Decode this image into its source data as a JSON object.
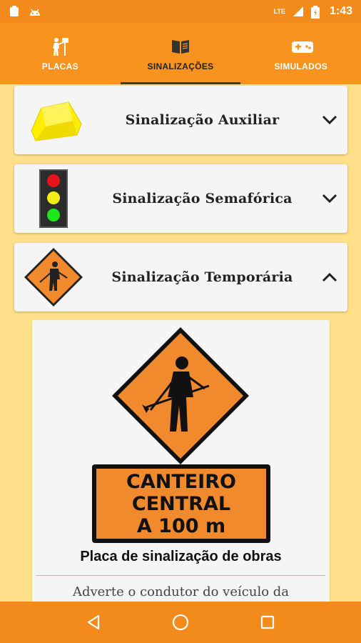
{
  "status": {
    "time": "1:43",
    "network": "LTE"
  },
  "tabs": [
    {
      "label": "PLACAS",
      "icon": "person-sign-icon"
    },
    {
      "label": "SINALIZAÇÕES",
      "icon": "book-icon"
    },
    {
      "label": "SIMULADOS",
      "icon": "gamepad-icon"
    }
  ],
  "cards": [
    {
      "title": "Sinalização Auxiliar",
      "icon": "barrier-icon",
      "expanded": false
    },
    {
      "title": "Sinalização Semafórica",
      "icon": "traffic-light-icon",
      "expanded": false
    },
    {
      "title": "Sinalização Temporária",
      "icon": "roadwork-sign-icon",
      "expanded": true
    }
  ],
  "detail": {
    "sign_text": [
      "CANTEIRO",
      "CENTRAL",
      "A 100 m"
    ],
    "caption": "Placa de sinalização de obras",
    "description": "Adverte o condutor do veículo da"
  },
  "colors": {
    "primary": "#f7931e",
    "background": "#ffe08a",
    "sign_orange": "#f08a2c"
  }
}
